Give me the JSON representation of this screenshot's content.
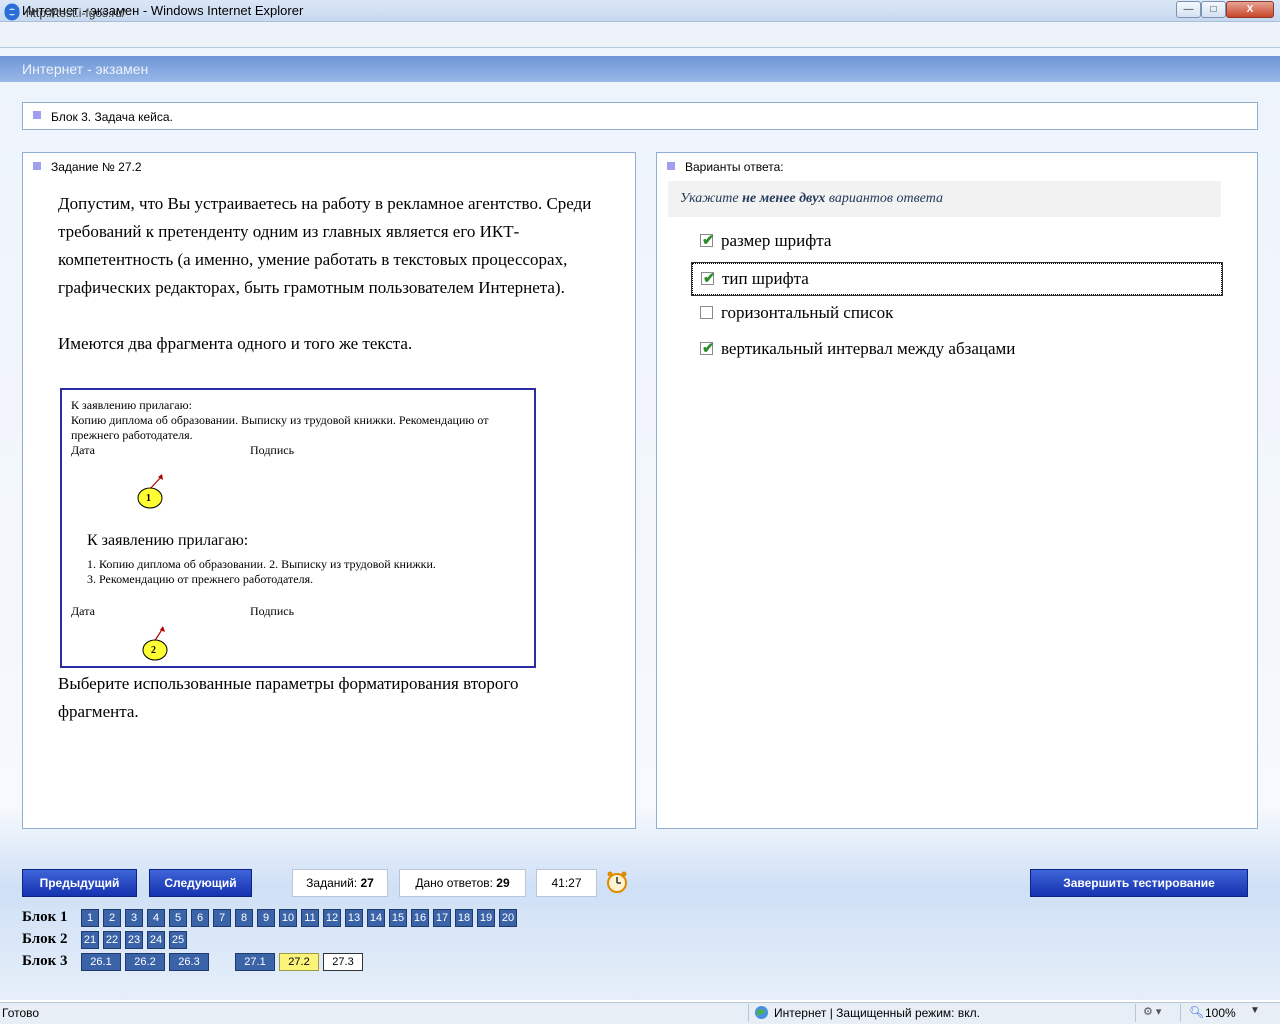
{
  "window": {
    "title": "Интернет - экзамен - Windows Internet Explorer",
    "min_label": "—",
    "max_label": "□",
    "close_label": "X"
  },
  "address": {
    "url": "http://test.i-fgos.ru/"
  },
  "header": {
    "title": "Интернет - экзамен"
  },
  "block": {
    "label": "Блок 3. Задача кейса."
  },
  "task": {
    "label": "Задание № 27.2",
    "paragraph1": "Допустим, что Вы устраиваетесь на работу в рекламное агентство. Среди требований к претенденту одним из главных является его ИКТ-компетентность (а именно, умение работать в текстовых процессорах, графических редакторах, быть грамотным пользователем Интернета).",
    "paragraph2": "Имеются два фрагмента одного и того же текста.",
    "paragraph3": "Выберите использованные параметры форматирования второго фрагмента.",
    "figure": {
      "f1_heading": "К заявлению прилагаю:",
      "f1_body": "Копию диплома об образовании. Выписку из трудовой книжки. Рекомендацию от прежнего работодателя.",
      "date": "Дата",
      "signature": "Подпись",
      "marker1": "1",
      "f2_heading": "К заявлению прилагаю:",
      "f2_line1": "1. Копию диплома об образовании. 2. Выписку  из трудовой книжки.",
      "f2_line2": "3. Рекомендацию от прежнего работодателя.",
      "marker2": "2"
    }
  },
  "answers": {
    "label": "Варианты ответа:",
    "hint_pre": "Укажите ",
    "hint_bold": "не менее двух",
    "hint_post": " вариантов ответа",
    "options": [
      {
        "label": "размер шрифта",
        "checked": true
      },
      {
        "label": "тип шрифта",
        "checked": true
      },
      {
        "label": "горизонтальный список",
        "checked": false
      },
      {
        "label": "вертикальный интервал между абзацами",
        "checked": true
      }
    ]
  },
  "controls": {
    "prev": "Предыдущий",
    "next": "Следующий",
    "count_label": "Заданий:",
    "count_value": "27",
    "answered_label": "Дано ответов:",
    "answered_value": "29",
    "timer": "41:27",
    "finish": "Завершить тестирование"
  },
  "blocks": [
    {
      "label": "Блок 1",
      "items": [
        "1",
        "2",
        "3",
        "4",
        "5",
        "6",
        "7",
        "8",
        "9",
        "10",
        "11",
        "12",
        "13",
        "14",
        "15",
        "16",
        "17",
        "18",
        "19",
        "20"
      ]
    },
    {
      "label": "Блок 2",
      "items": [
        "21",
        "22",
        "23",
        "24",
        "25"
      ]
    },
    {
      "label": "Блок 3",
      "items": [
        "26.1",
        "26.2",
        "26.3",
        "27.1",
        "27.2",
        "27.3"
      ]
    }
  ],
  "status": {
    "left": "Готово",
    "zone": "Интернет | Защищенный режим: вкл.",
    "zoom": "100%"
  }
}
